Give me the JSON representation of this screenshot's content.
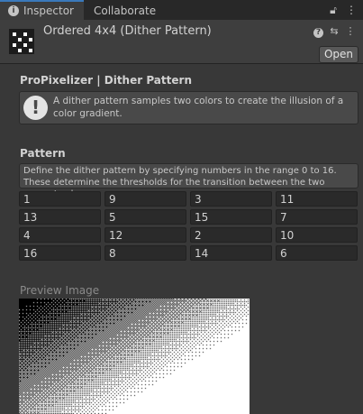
{
  "tabs": {
    "inspector": "Inspector",
    "collaborate": "Collaborate"
  },
  "asset": {
    "title": "Ordered 4x4 (Dither Pattern)",
    "open_label": "Open"
  },
  "component": {
    "title": "ProPixelizer | Dither Pattern",
    "info": "A dither pattern samples two colors to create the illusion of a color gradient."
  },
  "pattern": {
    "title": "Pattern",
    "help": "Define the dither pattern by specifying numbers in the range 0 to 16. These determine the thresholds for the transition between the two nearest colors.",
    "values": [
      "1",
      "9",
      "3",
      "11",
      "13",
      "5",
      "15",
      "7",
      "4",
      "12",
      "2",
      "10",
      "16",
      "8",
      "14",
      "6"
    ]
  },
  "preview": {
    "label": "Preview Image"
  },
  "icons": [
    "info-icon",
    "lock-icon",
    "kebab-menu-icon",
    "help-icon",
    "presets-icon",
    "more-options-icon",
    "warning-icon"
  ]
}
